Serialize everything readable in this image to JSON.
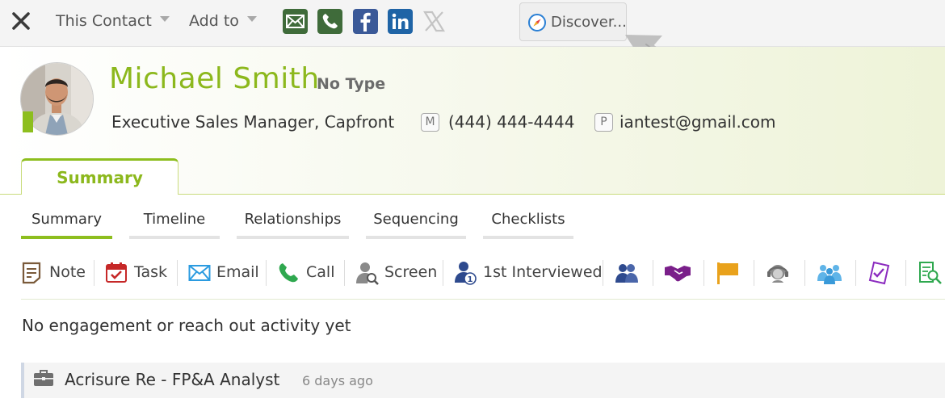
{
  "toolbar": {
    "menu_this_contact": "This Contact",
    "menu_add_to": "Add to",
    "discover_label": "Discover...",
    "icons": [
      "email-icon",
      "phone-icon",
      "facebook-icon",
      "linkedin-icon",
      "x-icon"
    ]
  },
  "contact": {
    "name": "Michael Smith",
    "type": "No Type",
    "job_line": "Executive Sales Manager, Capfront",
    "phone_tag": "M",
    "phone": "(444) 444-4444",
    "email_tag": "P",
    "email": "iantest@gmail.com"
  },
  "main_tab": "Summary",
  "sub_tabs": [
    "Summary",
    "Timeline",
    "Relationships",
    "Sequencing",
    "Checklists"
  ],
  "actions": {
    "note": "Note",
    "task": "Task",
    "email": "Email",
    "call": "Call",
    "screen": "Screen",
    "interviewed": "1st Interviewed"
  },
  "empty_message": "No engagement or reach out activity yet",
  "activity": {
    "title": "Acrisure Re - FP&A Analyst",
    "time_ago": "6 days ago"
  },
  "colors": {
    "brand_green": "#8cb81d",
    "email_green": "#3f6b3a",
    "facebook_blue": "#3b5998",
    "linkedin_blue": "#0e76a8",
    "action_blue": "#2e4a8e",
    "flag_orange": "#e9a21c",
    "purple": "#8b2bbf"
  }
}
